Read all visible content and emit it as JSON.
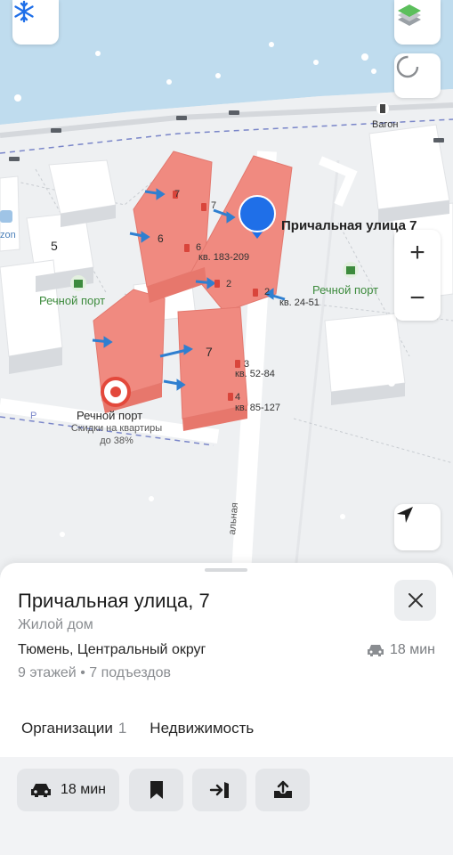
{
  "map": {
    "labels": {
      "address_pin": "Причальная улица 7",
      "house_5": "5",
      "house_6": "6",
      "house_7_mid": "7",
      "house_7_top": "7",
      "entrance_7": "7",
      "entrance_6": "6",
      "entrance_2a": "2",
      "entrance_2b": "2",
      "entrance_3": "3",
      "entrance_4": "4",
      "apt_range_1": "кв. 183-209",
      "apt_range_2": "кв. 24-51",
      "apt_range_3": "кв. 52-84",
      "apt_range_4": "кв. 85-127",
      "poi_left": "Речной порт",
      "poi_right": "Речной порт",
      "ad_title": "Речной порт",
      "ad_text_1": "Скидки на квартиры",
      "ad_text_2": "до 38%",
      "vagon": "Вагон",
      "zon": "zon",
      "street_vertical": "альная",
      "parking": "P"
    },
    "buttons": {
      "snow_icon": "snowflake-icon",
      "layers_icon": "layers-icon",
      "zoom_in": "+",
      "zoom_out": "−",
      "locate_icon": "navigation-arrow-icon"
    }
  },
  "card": {
    "title": "Причальная улица, 7",
    "subtitle": "Жилой дом",
    "address": "Тюмень, Центральный округ",
    "drive_time": "18 мин",
    "floors": "9 этажей • 7 подъездов",
    "tabs": [
      {
        "label": "Организации",
        "count": "1"
      },
      {
        "label": "Недвижимость",
        "count": ""
      }
    ],
    "actions": {
      "route_time": "18 мин"
    }
  },
  "colors": {
    "building_highlight": "#f08a80",
    "pin": "#1f6fe8",
    "poi_green": "#3d8b3d"
  }
}
